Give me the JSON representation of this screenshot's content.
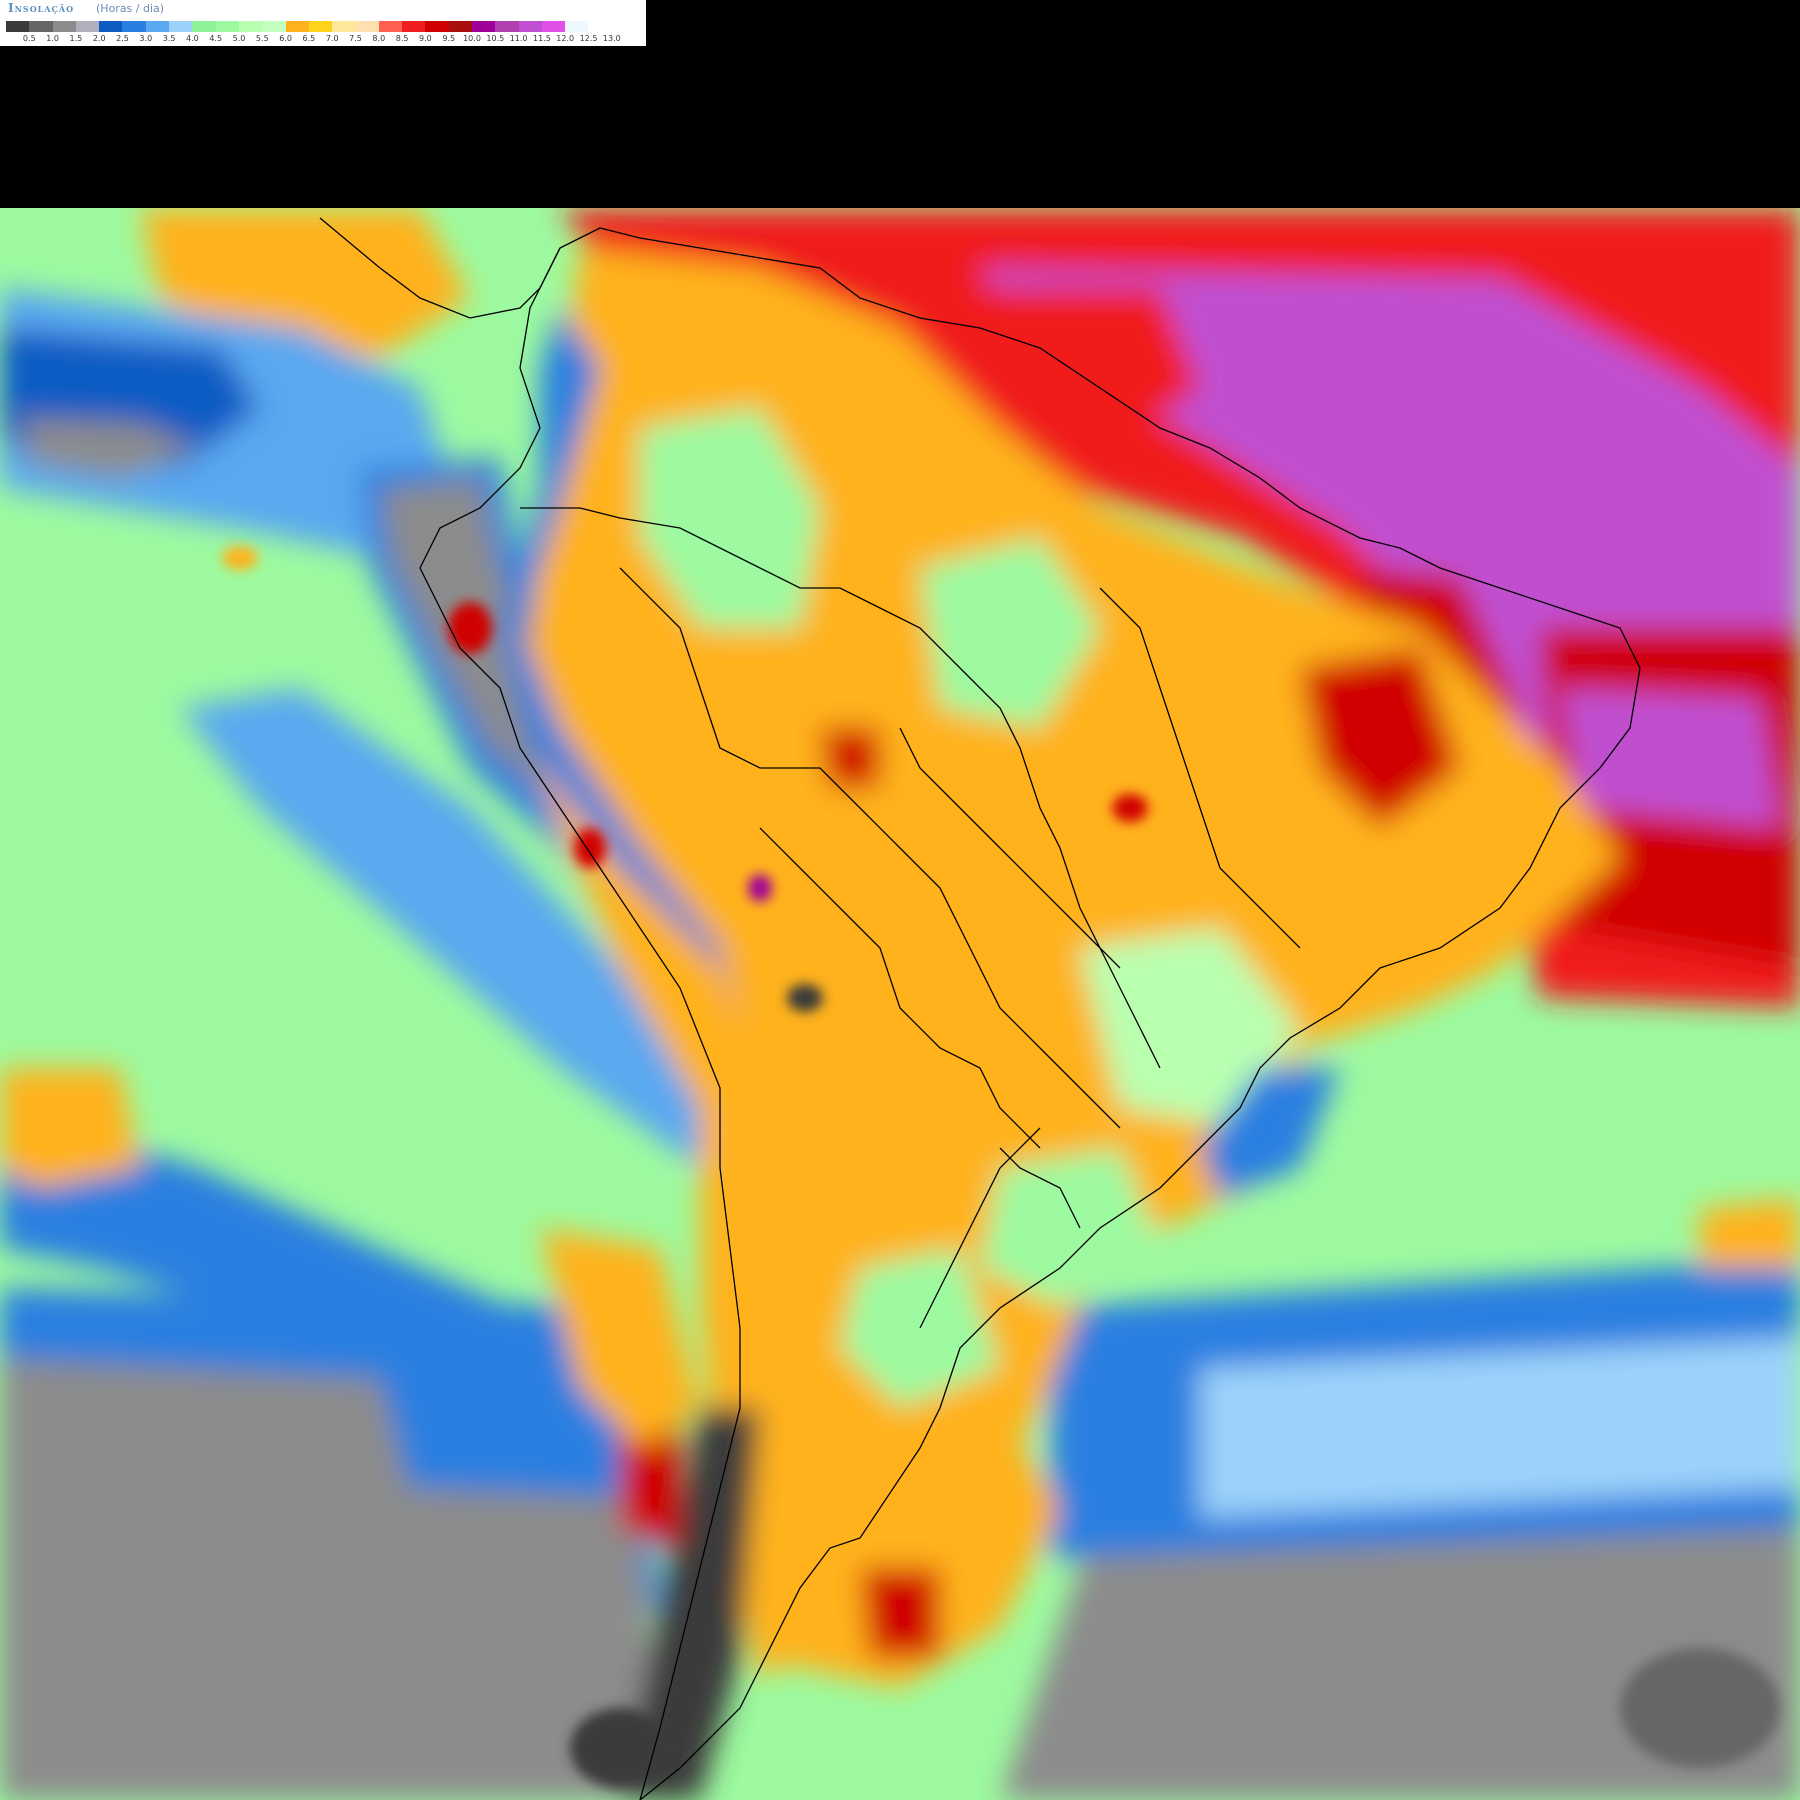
{
  "legend": {
    "title": "Insolação",
    "units": "(Horas / dia)",
    "colors": [
      "#3a3a3a",
      "#666666",
      "#8c8c8c",
      "#b0b0bc",
      "#0e5bc4",
      "#2b7fe0",
      "#5aa8f0",
      "#9cd2fa",
      "#8ef29a",
      "#9dfaa0",
      "#b9ffb0",
      "#c5ffc0",
      "#ffb21e",
      "#ffd21e",
      "#ffe79a",
      "#ffe0b0",
      "#ff6050",
      "#f01e1e",
      "#d00000",
      "#a81010",
      "#a0009a",
      "#b040b0",
      "#c050d0",
      "#e050e8",
      "#f0f8ff",
      "#ffffff"
    ],
    "ticks": [
      "0.5",
      "1.0",
      "1.5",
      "2.0",
      "2.5",
      "3.0",
      "3.5",
      "4.0",
      "4.5",
      "5.0",
      "5.5",
      "6.0",
      "6.5",
      "7.0",
      "7.5",
      "8.0",
      "8.5",
      "9.0",
      "9.5",
      "10.0",
      "10.5",
      "11.0",
      "11.5",
      "12.0",
      "12.5",
      "13.0"
    ]
  },
  "map": {
    "region": "South America",
    "variable": "insolation"
  }
}
